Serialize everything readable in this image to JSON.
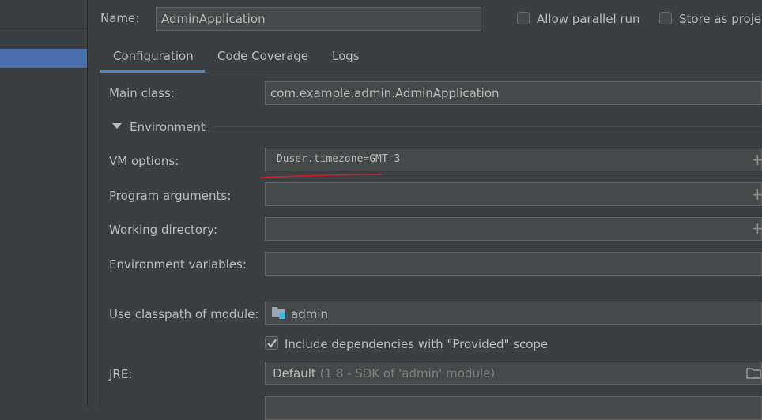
{
  "header": {
    "name_label": "Name:",
    "name_value": "AdminApplication",
    "allow_parallel_label": "Allow parallel run",
    "store_as_project_label": "Store as proje"
  },
  "tabs": [
    {
      "label": "Configuration",
      "selected": true
    },
    {
      "label": "Code Coverage",
      "selected": false
    },
    {
      "label": "Logs",
      "selected": false
    }
  ],
  "form": {
    "main_class_label": "Main class:",
    "main_class_value": "com.example.admin.AdminApplication",
    "environment_label": "Environment",
    "vm_options_label": "VM options:",
    "vm_options_value": "-Duser.timezone=GMT-3",
    "program_args_label": "Program arguments:",
    "working_dir_label": "Working directory:",
    "env_vars_label": "Environment variables:",
    "classpath_label": "Use classpath of module:",
    "classpath_value": "admin",
    "include_deps_label": "Include dependencies with \"Provided\" scope",
    "include_deps_checked": true,
    "jre_label": "JRE:",
    "jre_value": "Default",
    "jre_hint": "(1.8 - SDK of 'admin' module)",
    "plus_glyph": "+"
  },
  "colors": {
    "background": "#3c3f41",
    "field_bg": "#45494a",
    "accent": "#4a88c7",
    "selection": "#4b6eaf",
    "annotation_red": "#d0202a"
  },
  "icons": [
    "folder-module-icon",
    "folder-icon",
    "checkmark-icon",
    "expand-arrow-icon",
    "plus-icon"
  ]
}
